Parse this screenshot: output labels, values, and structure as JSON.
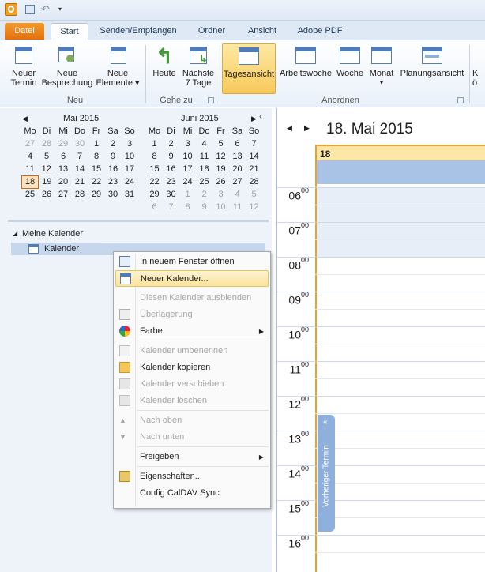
{
  "tabs": {
    "file": "Datei",
    "items": [
      "Start",
      "Senden/Empfangen",
      "Ordner",
      "Ansicht",
      "Adobe PDF"
    ]
  },
  "ribbon": {
    "neu": {
      "new_appointment": "Neuer\nTermin",
      "new_meeting": "Neue\nBesprechung",
      "new_items": "Neue\nElemente ▾",
      "label": "Neu"
    },
    "gehe_zu": {
      "today": "Heute",
      "next7": "Nächste\n7 Tage",
      "label": "Gehe zu"
    },
    "anordnen": {
      "day": "Tagesansicht",
      "workweek": "Arbeitswoche",
      "week": "Woche",
      "month": "Monat",
      "schedule": "Planungsansicht",
      "label": "Anordnen"
    },
    "cut_label": "K\nö"
  },
  "minical": {
    "may": {
      "title": "Mai 2015",
      "weekdays": [
        "Mo",
        "Di",
        "Mi",
        "Do",
        "Fr",
        "Sa",
        "So"
      ],
      "weeks": [
        [
          "27",
          "28",
          "29",
          "30",
          "1",
          "2",
          "3"
        ],
        [
          "4",
          "5",
          "6",
          "7",
          "8",
          "9",
          "10"
        ],
        [
          "11",
          "12",
          "13",
          "14",
          "15",
          "16",
          "17"
        ],
        [
          "18",
          "19",
          "20",
          "21",
          "22",
          "23",
          "24"
        ],
        [
          "25",
          "26",
          "27",
          "28",
          "29",
          "30",
          "31"
        ]
      ]
    },
    "june": {
      "title": "Juni 2015",
      "weekdays": [
        "Mo",
        "Di",
        "Mi",
        "Do",
        "Fr",
        "Sa",
        "So"
      ],
      "weeks": [
        [
          "1",
          "2",
          "3",
          "4",
          "5",
          "6",
          "7"
        ],
        [
          "8",
          "9",
          "10",
          "11",
          "12",
          "13",
          "14"
        ],
        [
          "15",
          "16",
          "17",
          "18",
          "19",
          "20",
          "21"
        ],
        [
          "22",
          "23",
          "24",
          "25",
          "26",
          "27",
          "28"
        ],
        [
          "29",
          "30",
          "1",
          "2",
          "3",
          "4",
          "5"
        ],
        [
          "6",
          "7",
          "8",
          "9",
          "10",
          "11",
          "12"
        ]
      ]
    }
  },
  "folders": {
    "group": "Meine Kalender",
    "item": "Kalender"
  },
  "context_menu": [
    {
      "label": "In neuem Fenster öffnen",
      "icon": "window-icon",
      "disabled": false
    },
    {
      "label": "Neuer Kalender...",
      "icon": "new-calendar-icon",
      "disabled": false,
      "highlight": true
    },
    {
      "label": "Diesen Kalender ausblenden",
      "disabled": true
    },
    {
      "label": "Überlagerung",
      "icon": "overlay-icon",
      "disabled": true
    },
    {
      "label": "Farbe",
      "icon": "color-icon",
      "disabled": false,
      "submenu": true
    },
    {
      "label": "Kalender umbenennen",
      "icon": "rename-icon",
      "disabled": true
    },
    {
      "label": "Kalender kopieren",
      "icon": "copy-folder-icon",
      "disabled": false
    },
    {
      "label": "Kalender verschieben",
      "icon": "move-folder-icon",
      "disabled": true
    },
    {
      "label": "Kalender löschen",
      "icon": "delete-icon",
      "disabled": true
    },
    {
      "label": "Nach oben",
      "icon": "arrow-up-icon",
      "disabled": true
    },
    {
      "label": "Nach unten",
      "icon": "arrow-down-icon",
      "disabled": true
    },
    {
      "label": "Freigeben",
      "disabled": false,
      "submenu": true
    },
    {
      "label": "Eigenschaften...",
      "icon": "properties-icon",
      "disabled": false
    },
    {
      "label": "Config CalDAV Sync",
      "disabled": false
    }
  ],
  "calendar_view": {
    "date_title": "18. Mai 2015",
    "day_header": "18",
    "hours": [
      "06",
      "07",
      "08",
      "09",
      "10",
      "11",
      "12",
      "13",
      "14",
      "15",
      "16"
    ],
    "minutes": "00",
    "prev_appointment": "Vorheriger Termin"
  },
  "colors": {
    "accent_orange": "#e2700f",
    "selection_yellow": "#f8c95a",
    "allday_blue": "#a9c3e6",
    "today_line": "#f0a030"
  }
}
